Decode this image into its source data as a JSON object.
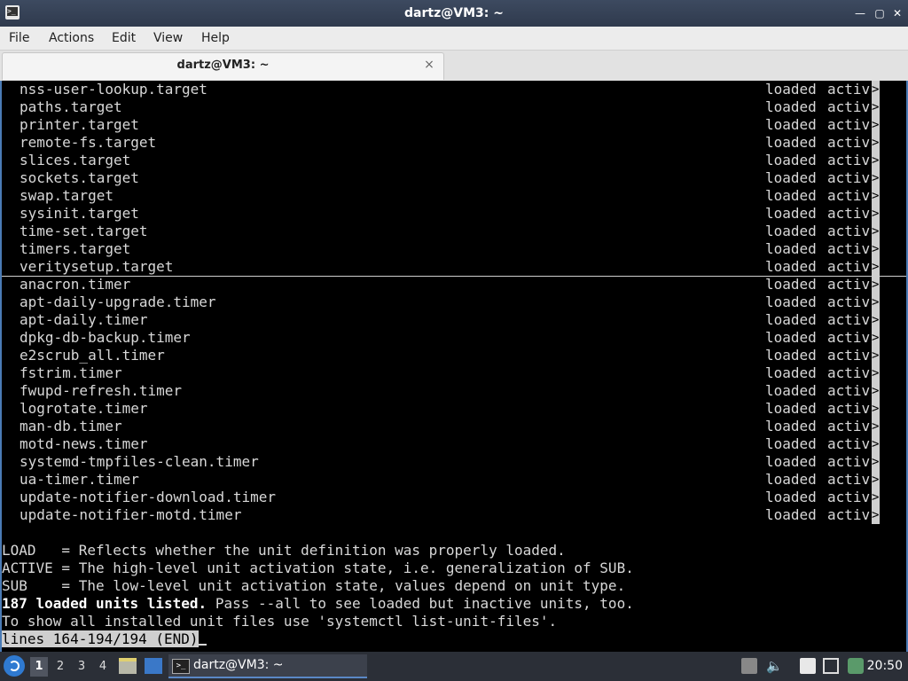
{
  "window": {
    "title": "dartz@VM3: ~"
  },
  "menu": [
    "File",
    "Actions",
    "Edit",
    "View",
    "Help"
  ],
  "tab": {
    "label": "dartz@VM3: ~",
    "close": "×"
  },
  "units": [
    {
      "unit": "nss-user-lookup.target",
      "load": "loaded",
      "active": "activ"
    },
    {
      "unit": "paths.target",
      "load": "loaded",
      "active": "activ"
    },
    {
      "unit": "printer.target",
      "load": "loaded",
      "active": "activ"
    },
    {
      "unit": "remote-fs.target",
      "load": "loaded",
      "active": "activ"
    },
    {
      "unit": "slices.target",
      "load": "loaded",
      "active": "activ"
    },
    {
      "unit": "sockets.target",
      "load": "loaded",
      "active": "activ"
    },
    {
      "unit": "swap.target",
      "load": "loaded",
      "active": "activ"
    },
    {
      "unit": "sysinit.target",
      "load": "loaded",
      "active": "activ"
    },
    {
      "unit": "time-set.target",
      "load": "loaded",
      "active": "activ"
    },
    {
      "unit": "timers.target",
      "load": "loaded",
      "active": "activ"
    },
    {
      "unit": "veritysetup.target",
      "load": "loaded",
      "active": "activ"
    },
    {
      "unit": "anacron.timer",
      "load": "loaded",
      "active": "activ"
    },
    {
      "unit": "apt-daily-upgrade.timer",
      "load": "loaded",
      "active": "activ"
    },
    {
      "unit": "apt-daily.timer",
      "load": "loaded",
      "active": "activ"
    },
    {
      "unit": "dpkg-db-backup.timer",
      "load": "loaded",
      "active": "activ"
    },
    {
      "unit": "e2scrub_all.timer",
      "load": "loaded",
      "active": "activ"
    },
    {
      "unit": "fstrim.timer",
      "load": "loaded",
      "active": "activ"
    },
    {
      "unit": "fwupd-refresh.timer",
      "load": "loaded",
      "active": "activ"
    },
    {
      "unit": "logrotate.timer",
      "load": "loaded",
      "active": "activ"
    },
    {
      "unit": "man-db.timer",
      "load": "loaded",
      "active": "activ"
    },
    {
      "unit": "motd-news.timer",
      "load": "loaded",
      "active": "activ"
    },
    {
      "unit": "systemd-tmpfiles-clean.timer",
      "load": "loaded",
      "active": "activ"
    },
    {
      "unit": "ua-timer.timer",
      "load": "loaded",
      "active": "activ"
    },
    {
      "unit": "update-notifier-download.timer",
      "load": "loaded",
      "active": "activ"
    },
    {
      "unit": "update-notifier-motd.timer",
      "load": "loaded",
      "active": "activ"
    }
  ],
  "legend": {
    "load": "LOAD   = Reflects whether the unit definition was properly loaded.",
    "active": "ACTIVE = The high-level unit activation state, i.e. generalization of SUB.",
    "sub": "SUB    = The low-level unit activation state, values depend on unit type.",
    "count_bold": "187 loaded units listed.",
    "count_rest": " Pass --all to see loaded but inactive units, too.",
    "hint": "To show all installed unit files use 'systemctl list-unit-files'.",
    "status": "lines 164-194/194 (END)"
  },
  "taskbar": {
    "workspaces": [
      "1",
      "2",
      "3",
      "4"
    ],
    "current_workspace": "1",
    "task_label": "dartz@VM3: ~",
    "clock": "20:50"
  }
}
